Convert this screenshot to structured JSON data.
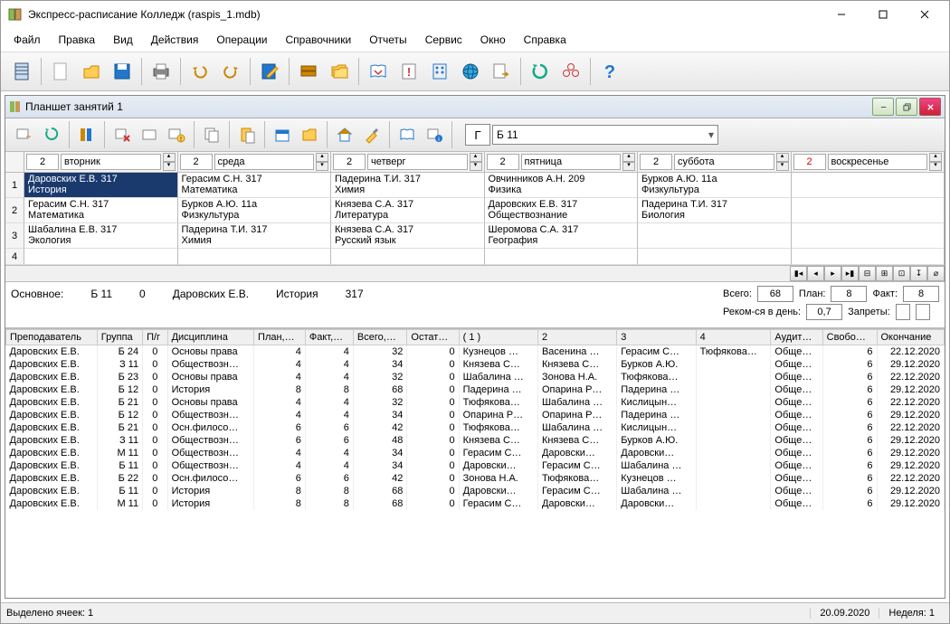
{
  "window_title": "Экспресс-расписание Колледж (raspis_1.mdb)",
  "menus": [
    "Файл",
    "Правка",
    "Вид",
    "Действия",
    "Операции",
    "Справочники",
    "Отчеты",
    "Сервис",
    "Окно",
    "Справка"
  ],
  "subwindow_title": "Планшет занятий 1",
  "combo_g": "Г",
  "combo_group": "Б 11",
  "days": [
    {
      "num": "2",
      "name": "вторник"
    },
    {
      "num": "2",
      "name": "среда"
    },
    {
      "num": "2",
      "name": "четверг"
    },
    {
      "num": "2",
      "name": "пятница"
    },
    {
      "num": "2",
      "name": "суббота"
    },
    {
      "num": "2",
      "name": "воскресенье"
    }
  ],
  "rows": [
    {
      "n": "1",
      "cells": [
        {
          "l1": "Даровских Е.В.   317",
          "l2": "История",
          "sel": true
        },
        {
          "l1": "Герасим С.Н.   317",
          "l2": "Математика"
        },
        {
          "l1": "Падерина Т.И.   317",
          "l2": "Химия"
        },
        {
          "l1": "Овчинников А.Н.   209",
          "l2": "Физика"
        },
        {
          "l1": "Бурков А.Ю.   11а",
          "l2": "Физкультура"
        },
        {
          "l1": "",
          "l2": ""
        }
      ]
    },
    {
      "n": "2",
      "cells": [
        {
          "l1": "Герасим С.Н.   317",
          "l2": "Математика"
        },
        {
          "l1": "Бурков А.Ю.   11а",
          "l2": "Физкультура"
        },
        {
          "l1": "Князева С.А.   317",
          "l2": "Литература"
        },
        {
          "l1": "Даровских Е.В.   317",
          "l2": "Обществознание"
        },
        {
          "l1": "Падерина Т.И.   317",
          "l2": "Биология"
        },
        {
          "l1": "",
          "l2": ""
        }
      ]
    },
    {
      "n": "3",
      "cells": [
        {
          "l1": "Шабалина Е.В.   317",
          "l2": "Экология"
        },
        {
          "l1": "Падерина Т.И.   317",
          "l2": "Химия"
        },
        {
          "l1": "Князева С.А.   317",
          "l2": "Русский язык"
        },
        {
          "l1": "Шеромова С.А.   317",
          "l2": "География"
        },
        {
          "l1": "",
          "l2": ""
        },
        {
          "l1": "",
          "l2": ""
        }
      ]
    },
    {
      "n": "4",
      "cells": [
        {
          "l1": ""
        },
        {
          "l1": ""
        },
        {
          "l1": ""
        },
        {
          "l1": ""
        },
        {
          "l1": ""
        },
        {
          "l1": ""
        }
      ]
    }
  ],
  "info": {
    "label": "Основное:",
    "group": "Б 11",
    "zero": "0",
    "teacher": "Даровских Е.В.",
    "subject": "История",
    "room": "317"
  },
  "stats": {
    "vsego_l": "Всего:",
    "vsego": "68",
    "plan_l": "План:",
    "plan": "8",
    "fact_l": "Факт:",
    "fact": "8",
    "rekom_l": "Реком-ся в день:",
    "rekom": "0,7",
    "zapret_l": "Запреты:"
  },
  "columns": [
    "Преподаватель",
    "Группа",
    "П/г",
    "Дисциплина",
    "План,…",
    "Факт,…",
    "Всего,…",
    "Остат…",
    "( 1 )",
    "2",
    "3",
    "4",
    "Аудит…",
    "Свобо…",
    "Окончание"
  ],
  "data": [
    [
      "Даровских Е.В.",
      "Б 24",
      "0",
      "Основы права",
      "4",
      "4",
      "32",
      "0",
      "Кузнецов …",
      "Васенина …",
      "Герасим С…",
      "Тюфякова…",
      "Обще…",
      "6",
      "22.12.2020"
    ],
    [
      "Даровских Е.В.",
      "З 11",
      "0",
      "Обществозн…",
      "4",
      "4",
      "34",
      "0",
      "Князева С…",
      "Князева С…",
      "Бурков А.Ю.",
      "",
      "Обще…",
      "6",
      "29.12.2020"
    ],
    [
      "Даровских Е.В.",
      "Б 23",
      "0",
      "Основы права",
      "4",
      "4",
      "32",
      "0",
      "Шабалина …",
      "Зонова Н.А.",
      "Тюфякова…",
      "",
      "Обще…",
      "6",
      "22.12.2020"
    ],
    [
      "Даровских Е.В.",
      "Б 12",
      "0",
      "История",
      "8",
      "8",
      "68",
      "0",
      "Падерина …",
      "Опарина Р…",
      "Падерина …",
      "",
      "Обще…",
      "6",
      "29.12.2020"
    ],
    [
      "Даровских Е.В.",
      "Б 21",
      "0",
      "Основы права",
      "4",
      "4",
      "32",
      "0",
      "Тюфякова…",
      "Шабалина …",
      "Кислицын…",
      "",
      "Обще…",
      "6",
      "22.12.2020"
    ],
    [
      "Даровских Е.В.",
      "Б 12",
      "0",
      "Обществозн…",
      "4",
      "4",
      "34",
      "0",
      "Опарина Р…",
      "Опарина Р…",
      "Падерина …",
      "",
      "Обще…",
      "6",
      "29.12.2020"
    ],
    [
      "Даровских Е.В.",
      "Б 21",
      "0",
      "Осн.филосо…",
      "6",
      "6",
      "42",
      "0",
      "Тюфякова…",
      "Шабалина …",
      "Кислицын…",
      "",
      "Обще…",
      "6",
      "22.12.2020"
    ],
    [
      "Даровских Е.В.",
      "З 11",
      "0",
      "Обществозн…",
      "6",
      "6",
      "48",
      "0",
      "Князева С…",
      "Князева С…",
      "Бурков А.Ю.",
      "",
      "Обще…",
      "6",
      "29.12.2020"
    ],
    [
      "Даровских Е.В.",
      "М 11",
      "0",
      "Обществозн…",
      "4",
      "4",
      "34",
      "0",
      "Герасим С…",
      "Даровски…",
      "Даровски…",
      "",
      "Обще…",
      "6",
      "29.12.2020"
    ],
    [
      "Даровских Е.В.",
      "Б 11",
      "0",
      "Обществозн…",
      "4",
      "4",
      "34",
      "0",
      "Даровски…",
      "Герасим С…",
      "Шабалина …",
      "",
      "Обще…",
      "6",
      "29.12.2020"
    ],
    [
      "Даровских Е.В.",
      "Б 22",
      "0",
      "Осн.филосо…",
      "6",
      "6",
      "42",
      "0",
      "Зонова Н.А.",
      "Тюфякова…",
      "Кузнецов …",
      "",
      "Обще…",
      "6",
      "22.12.2020"
    ],
    [
      "Даровских Е.В.",
      "Б 11",
      "0",
      "История",
      "8",
      "8",
      "68",
      "0",
      "Даровски…",
      "Герасим С…",
      "Шабалина …",
      "",
      "Обще…",
      "6",
      "29.12.2020"
    ],
    [
      "Даровских Е.В.",
      "М 11",
      "0",
      "История",
      "8",
      "8",
      "68",
      "0",
      "Герасим С…",
      "Даровски…",
      "Даровски…",
      "",
      "Обще…",
      "6",
      "29.12.2020"
    ]
  ],
  "status": {
    "sel": "Выделено ячеек: 1",
    "date": "20.09.2020",
    "week": "Неделя: 1"
  }
}
